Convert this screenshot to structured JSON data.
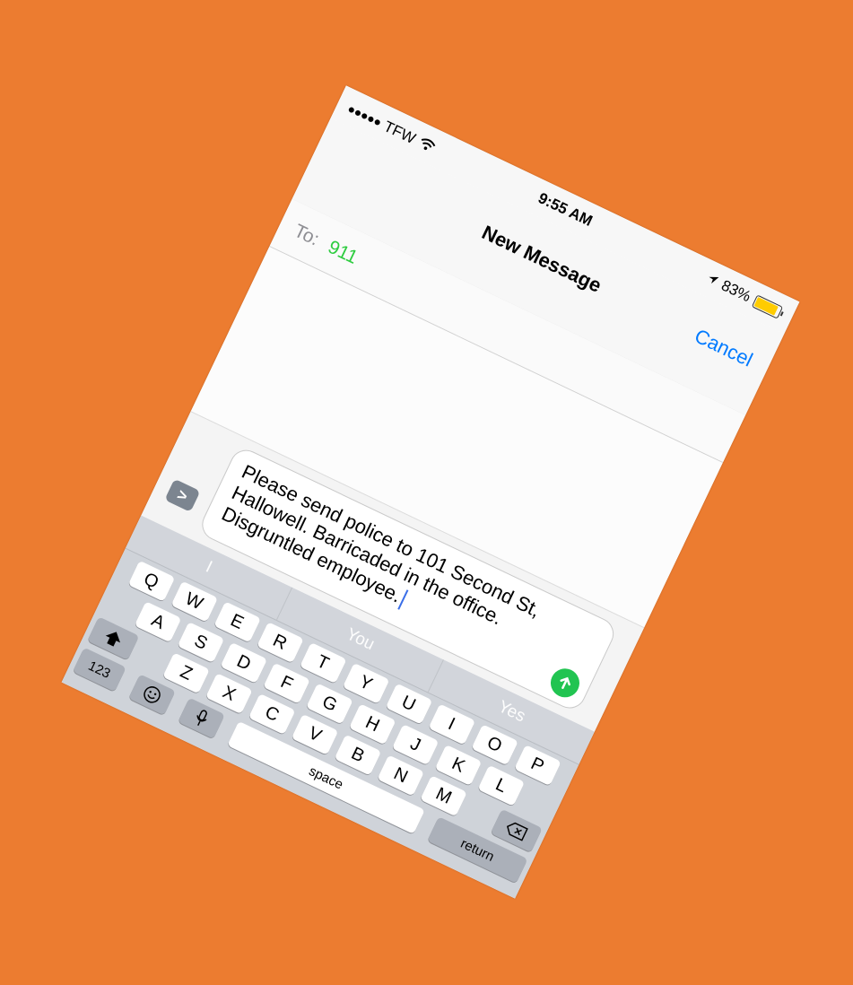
{
  "status_bar": {
    "carrier": "TFW",
    "time": "9:55 AM",
    "battery": "83%",
    "signal_dots": 5,
    "battery_level": 0.83
  },
  "nav": {
    "title": "New Message",
    "cancel_label": "Cancel"
  },
  "compose": {
    "to_label": "To:",
    "recipient": "911",
    "message": "Please send police to 101 Second St, Hallowell. Barricaded in the office. Disgruntled employee.",
    "expand_label": ">"
  },
  "keyboard": {
    "suggestions": [
      "I",
      "You",
      "Yes"
    ],
    "row1": [
      "Q",
      "W",
      "E",
      "R",
      "T",
      "Y",
      "U",
      "I",
      "O",
      "P"
    ],
    "row2": [
      "A",
      "S",
      "D",
      "F",
      "G",
      "H",
      "J",
      "K",
      "L"
    ],
    "row3": [
      "Z",
      "X",
      "C",
      "V",
      "B",
      "N",
      "M"
    ],
    "numbers_label": "123",
    "space_label": "space",
    "return_label": "return"
  },
  "colors": {
    "background": "#EC7C30",
    "accent": "#007AFF",
    "recipient": "#2ECC40",
    "send": "#21C451",
    "battery": "#FFCC00"
  },
  "icons": [
    "wifi-icon",
    "location-arrow-icon",
    "battery-icon",
    "send-arrow-icon",
    "shift-icon",
    "emoji-icon",
    "microphone-icon",
    "backspace-icon"
  ]
}
